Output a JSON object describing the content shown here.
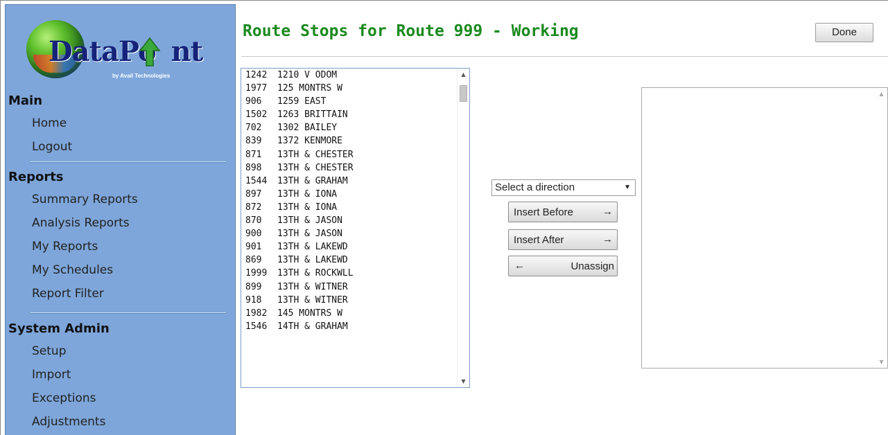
{
  "logo": {
    "text_a": "DataPo",
    "text_b": "nt",
    "subtitle": "by Avail Technologies"
  },
  "sidebar": {
    "groups": [
      {
        "heading": "Main",
        "items": [
          "Home",
          "Logout"
        ]
      },
      {
        "heading": "Reports",
        "items": [
          "Summary Reports",
          "Analysis Reports",
          "My Reports",
          "My Schedules",
          "Report Filter"
        ]
      },
      {
        "heading": "System Admin",
        "items": [
          "Setup",
          "Import",
          "Exceptions",
          "Adjustments"
        ]
      }
    ]
  },
  "page": {
    "title": "Route Stops for Route 999 - Working",
    "done_label": "Done"
  },
  "stops": [
    {
      "id": "1242",
      "name": "1210 V ODOM"
    },
    {
      "id": "1977",
      "name": "125 MONTRS W"
    },
    {
      "id": "906",
      "name": "1259 EAST"
    },
    {
      "id": "1502",
      "name": "1263 BRITTAIN"
    },
    {
      "id": "702",
      "name": "1302 BAILEY"
    },
    {
      "id": "839",
      "name": "1372 KENMORE"
    },
    {
      "id": "871",
      "name": "13TH & CHESTER"
    },
    {
      "id": "898",
      "name": "13TH & CHESTER"
    },
    {
      "id": "1544",
      "name": "13TH & GRAHAM"
    },
    {
      "id": "897",
      "name": "13TH & IONA"
    },
    {
      "id": "872",
      "name": "13TH & IONA"
    },
    {
      "id": "870",
      "name": "13TH & JASON"
    },
    {
      "id": "900",
      "name": "13TH & JASON"
    },
    {
      "id": "901",
      "name": "13TH & LAKEWD"
    },
    {
      "id": "869",
      "name": "13TH & LAKEWD"
    },
    {
      "id": "1999",
      "name": "13TH & ROCKWLL"
    },
    {
      "id": "899",
      "name": "13TH & WITNER"
    },
    {
      "id": "918",
      "name": "13TH & WITNER"
    },
    {
      "id": "1982",
      "name": "145 MONTRS W"
    },
    {
      "id": "1546",
      "name": "14TH & GRAHAM"
    }
  ],
  "controls": {
    "direction_selected": "Select a direction",
    "insert_before": "Insert Before",
    "insert_after": "Insert After",
    "unassign": "Unassign",
    "arrow_right": "→",
    "arrow_left": "←"
  },
  "colors": {
    "sidebar_bg": "#7ea6da",
    "title_green": "#1b8a20"
  },
  "icons": {
    "scroll_up": "▲",
    "scroll_down": "▼",
    "dropdown": "▼"
  }
}
